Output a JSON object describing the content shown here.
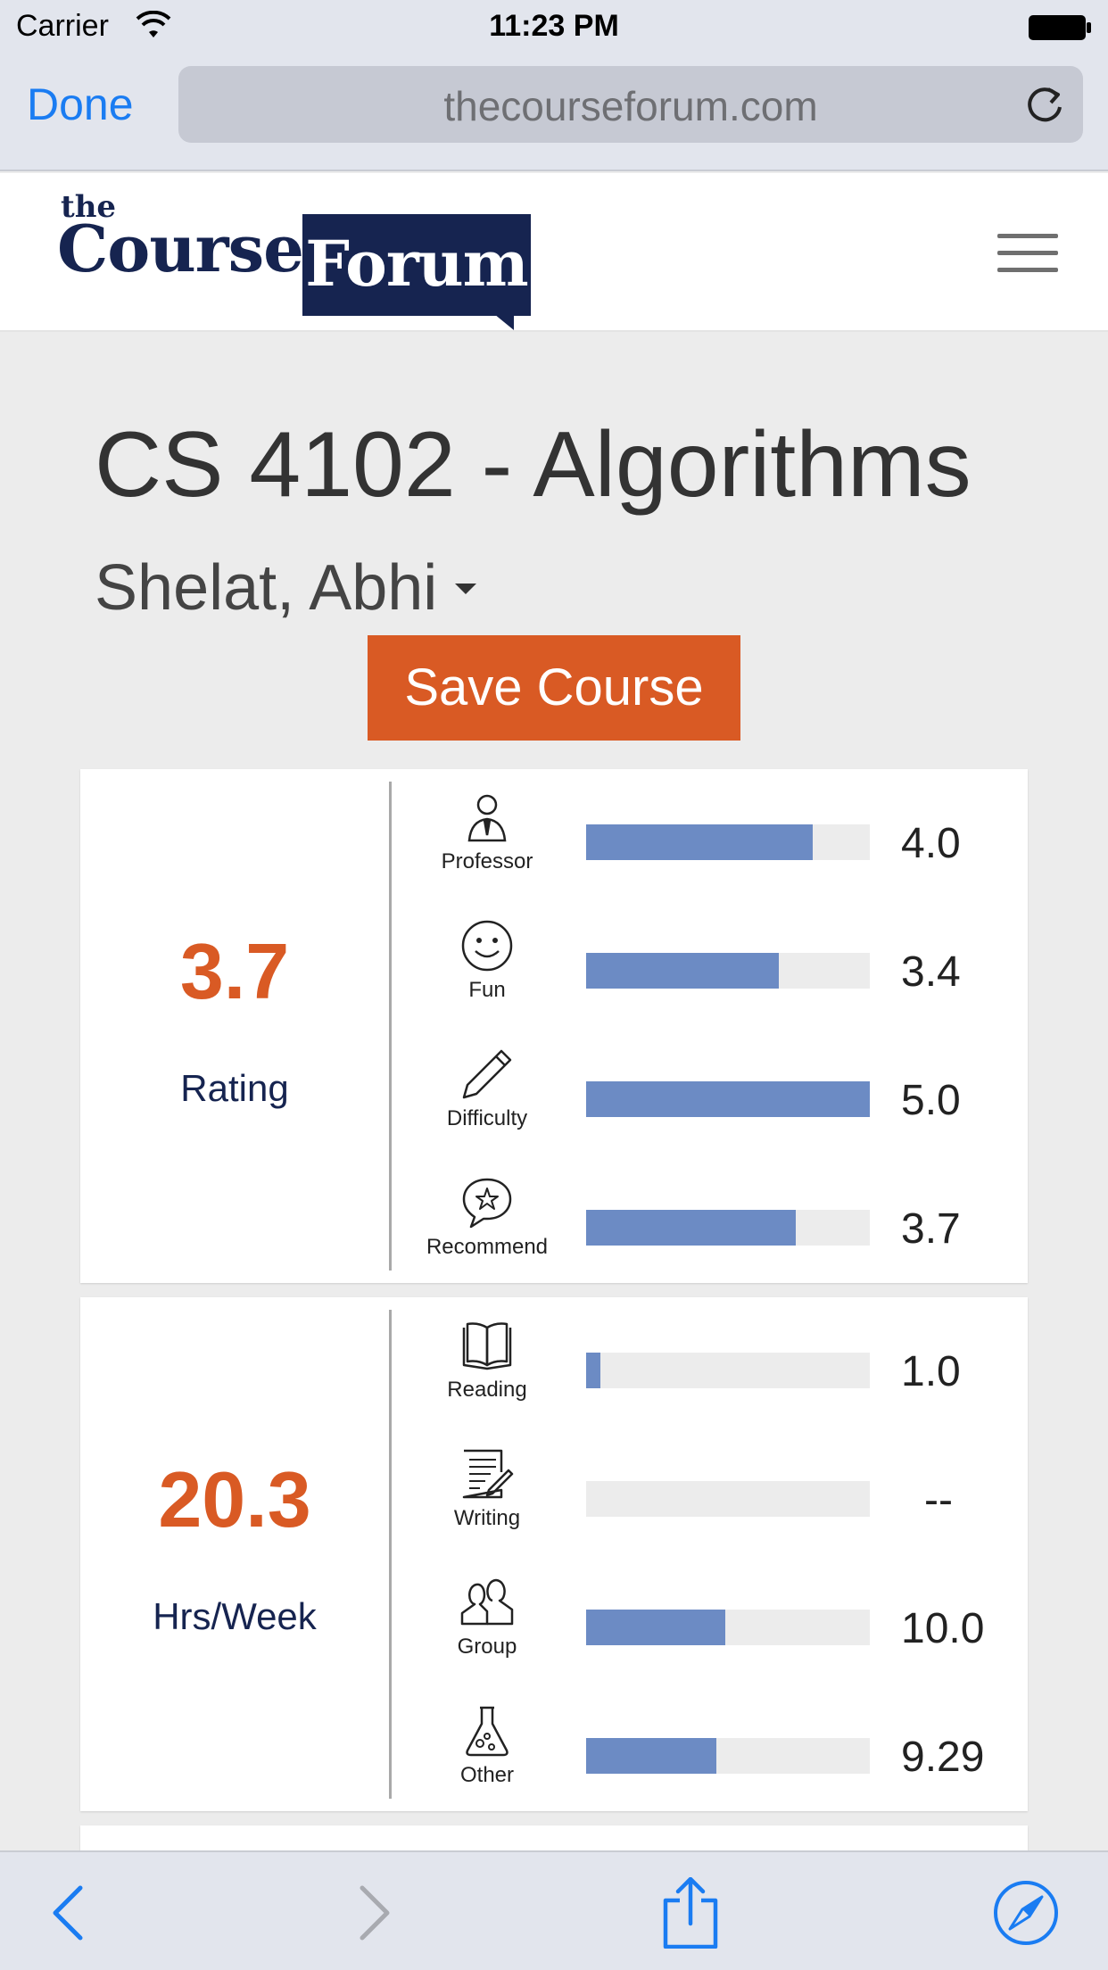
{
  "status_bar": {
    "carrier": "Carrier",
    "time": "11:23 PM"
  },
  "browser": {
    "done_label": "Done",
    "url": "thecourseforum.com"
  },
  "site": {
    "logo_the": "the",
    "logo_course": "Course",
    "logo_forum": "Forum"
  },
  "course": {
    "title": "CS 4102 - Algorithms",
    "instructor": "Shelat, Abhi",
    "save_label": "Save Course"
  },
  "rating_card": {
    "value": "3.7",
    "label": "Rating",
    "metrics": [
      {
        "label": "Professor",
        "value": "4.0",
        "fraction": 0.8,
        "icon": "professor-icon"
      },
      {
        "label": "Fun",
        "value": "3.4",
        "fraction": 0.68,
        "icon": "smiley-icon"
      },
      {
        "label": "Difficulty",
        "value": "5.0",
        "fraction": 1.0,
        "icon": "pencil-icon"
      },
      {
        "label": "Recommend",
        "value": "3.7",
        "fraction": 0.74,
        "icon": "star-bubble-icon"
      }
    ]
  },
  "workload_card": {
    "value": "20.3",
    "label": "Hrs/Week",
    "metrics": [
      {
        "label": "Reading",
        "value": "1.0",
        "fraction": 0.05,
        "icon": "book-icon"
      },
      {
        "label": "Writing",
        "value": "--",
        "fraction": 0.0,
        "icon": "writing-icon"
      },
      {
        "label": "Group",
        "value": "10.0",
        "fraction": 0.49,
        "icon": "group-icon"
      },
      {
        "label": "Other",
        "value": "9.29",
        "fraction": 0.46,
        "icon": "flask-icon"
      }
    ]
  },
  "colors": {
    "accent": "#d95a24",
    "brand_navy": "#162450",
    "bar": "#6c8bc4",
    "ios_blue": "#1a7cf2"
  }
}
